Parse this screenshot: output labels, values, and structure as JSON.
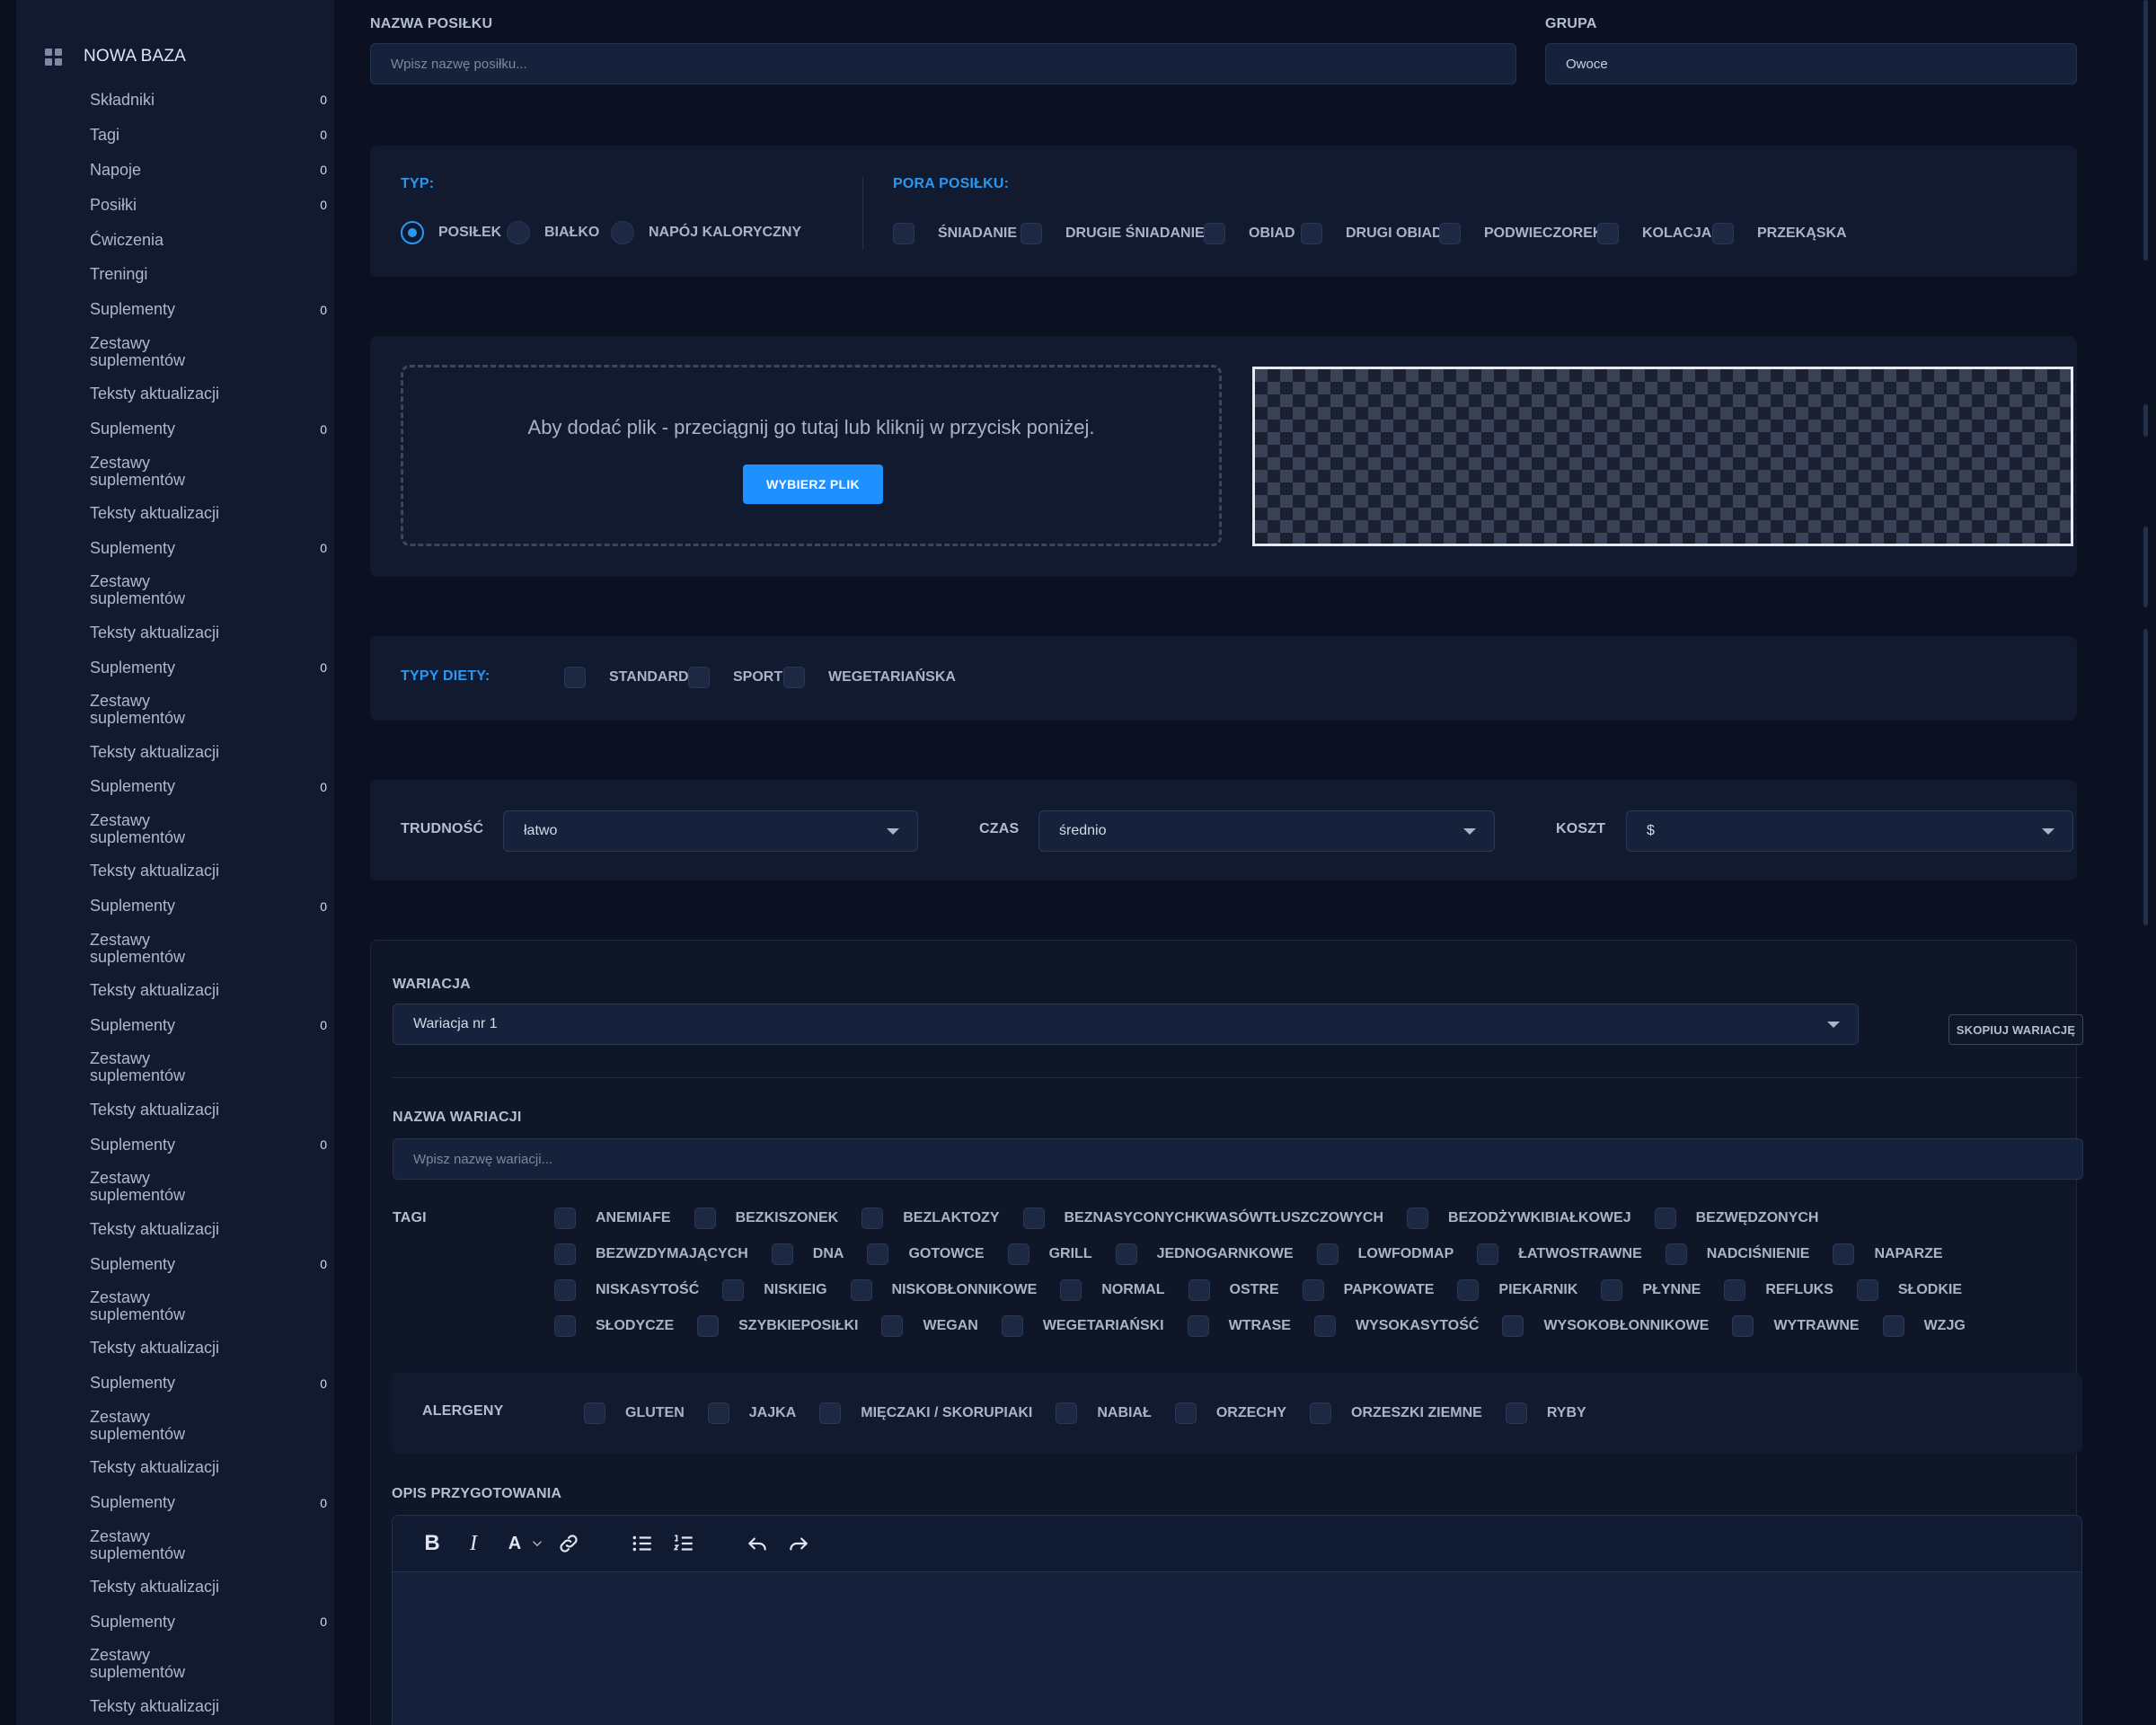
{
  "sidebar": {
    "title": "NOWA BAZA",
    "items": [
      {
        "label": "Składniki",
        "count": "0"
      },
      {
        "label": "Tagi",
        "count": "0"
      },
      {
        "label": "Napoje",
        "count": "0"
      },
      {
        "label": "Posiłki",
        "count": "0"
      },
      {
        "label": "Ćwiczenia",
        "count": ""
      },
      {
        "label": "Treningi",
        "count": ""
      },
      {
        "label": "Suplementy",
        "count": "0"
      },
      {
        "label": "Zestawy suplementów",
        "count": ""
      },
      {
        "label": "Teksty aktualizacji",
        "count": ""
      },
      {
        "label": "Suplementy",
        "count": "0"
      },
      {
        "label": "Zestawy suplementów",
        "count": ""
      },
      {
        "label": "Teksty aktualizacji",
        "count": ""
      },
      {
        "label": "Suplementy",
        "count": "0"
      },
      {
        "label": "Zestawy suplementów",
        "count": ""
      },
      {
        "label": "Teksty aktualizacji",
        "count": ""
      },
      {
        "label": "Suplementy",
        "count": "0"
      },
      {
        "label": "Zestawy suplementów",
        "count": ""
      },
      {
        "label": "Teksty aktualizacji",
        "count": ""
      },
      {
        "label": "Suplementy",
        "count": "0"
      },
      {
        "label": "Zestawy suplementów",
        "count": ""
      },
      {
        "label": "Teksty aktualizacji",
        "count": ""
      },
      {
        "label": "Suplementy",
        "count": "0"
      },
      {
        "label": "Zestawy suplementów",
        "count": ""
      },
      {
        "label": "Teksty aktualizacji",
        "count": ""
      },
      {
        "label": "Suplementy",
        "count": "0"
      },
      {
        "label": "Zestawy suplementów",
        "count": ""
      },
      {
        "label": "Teksty aktualizacji",
        "count": ""
      },
      {
        "label": "Suplementy",
        "count": "0"
      },
      {
        "label": "Zestawy suplementów",
        "count": ""
      },
      {
        "label": "Teksty aktualizacji",
        "count": ""
      },
      {
        "label": "Suplementy",
        "count": "0"
      },
      {
        "label": "Zestawy suplementów",
        "count": ""
      },
      {
        "label": "Teksty aktualizacji",
        "count": ""
      },
      {
        "label": "Suplementy",
        "count": "0"
      },
      {
        "label": "Zestawy suplementów",
        "count": ""
      },
      {
        "label": "Teksty aktualizacji",
        "count": ""
      },
      {
        "label": "Suplementy",
        "count": "0"
      },
      {
        "label": "Zestawy suplementów",
        "count": ""
      },
      {
        "label": "Teksty aktualizacji",
        "count": ""
      },
      {
        "label": "Suplementy",
        "count": "0"
      },
      {
        "label": "Zestawy suplementów",
        "count": ""
      },
      {
        "label": "Teksty aktualizacji",
        "count": ""
      }
    ]
  },
  "meal": {
    "name_label": "NAZWA POSIŁKU",
    "name_placeholder": "Wpisz nazwę posiłku...",
    "group_label": "GRUPA",
    "group_value": "Owoce"
  },
  "type": {
    "label": "TYP:",
    "options": [
      "POSIŁEK",
      "BIAŁKO",
      "NAPÓJ KALORYCZNY"
    ],
    "selected": "POSIŁEK"
  },
  "time_of_day": {
    "label": "PORA POSIŁKU:",
    "options": [
      "ŚNIADANIE",
      "DRUGIE ŚNIADANIE",
      "OBIAD",
      "DRUGI OBIAD",
      "PODWIECZOREK",
      "KOLACJA",
      "PRZEKĄSKA"
    ]
  },
  "upload": {
    "hint": "Aby dodać plik - przeciągnij go tutaj lub kliknij w przycisk poniżej.",
    "button": "WYBIERZ PLIK"
  },
  "diet": {
    "label": "TYPY DIETY:",
    "options": [
      "STANDARD",
      "SPORT",
      "WEGETARIAŃSKA"
    ]
  },
  "params": {
    "difficulty_label": "TRUDNOŚĆ",
    "difficulty_value": "łatwo",
    "time_label": "CZAS",
    "time_value": "średnio",
    "cost_label": "KOSZT",
    "cost_value": "$"
  },
  "variation": {
    "label": "WARIACJA",
    "value": "Wariacja nr 1",
    "copy_button": "SKOPIUJ WARIACJĘ",
    "name_label": "NAZWA WARIACJI",
    "name_placeholder": "Wpisz nazwę wariacji...",
    "tags_label": "TAGI",
    "tags": [
      "ANEMIAFE",
      "BEZKISZONEK",
      "BEZLAKTOZY",
      "BEZNASYCONYCHKWASÓWTŁUSZCZOWYCH",
      "BEZODŻYWKIBIAŁKOWEJ",
      "BEZWĘDZONYCH",
      "BEZWZDYMAJĄCYCH",
      "DNA",
      "GOTOWCE",
      "GRILL",
      "JEDNOGARNKOWE",
      "LOWFODMAP",
      "ŁATWOSTRAWNE",
      "NADCIŚNIENIE",
      "NAPARZE",
      "NISKASYTOŚĆ",
      "NISKIEIG",
      "NISKOBŁONNIKOWE",
      "NORMAL",
      "OSTRE",
      "PAPKOWATE",
      "PIEKARNIK",
      "PŁYNNE",
      "REFLUKS",
      "SŁODKIE",
      "SŁODYCZE",
      "SZYBKIEPOSIŁKI",
      "WEGAN",
      "WEGETARIAŃSKI",
      "WTRASE",
      "WYSOKASYTOŚĆ",
      "WYSOKOBŁONNIKOWE",
      "WYTRAWNE",
      "WZJG"
    ],
    "allergens_label": "ALERGENY",
    "allergens": [
      "GLUTEN",
      "JAJKA",
      "MIĘCZAKI / SKORUPIAKI",
      "NABIAŁ",
      "ORZECHY",
      "ORZESZKI ZIEMNE",
      "RYBY"
    ],
    "description_label": "OPIS PRZYGOTOWANIA"
  },
  "editor_toolbar": [
    "bold-icon",
    "italic-icon",
    "text-color-icon",
    "chevron-down-icon",
    "link-icon",
    "bullet-list-icon",
    "numbered-list-icon",
    "undo-icon",
    "redo-icon"
  ]
}
